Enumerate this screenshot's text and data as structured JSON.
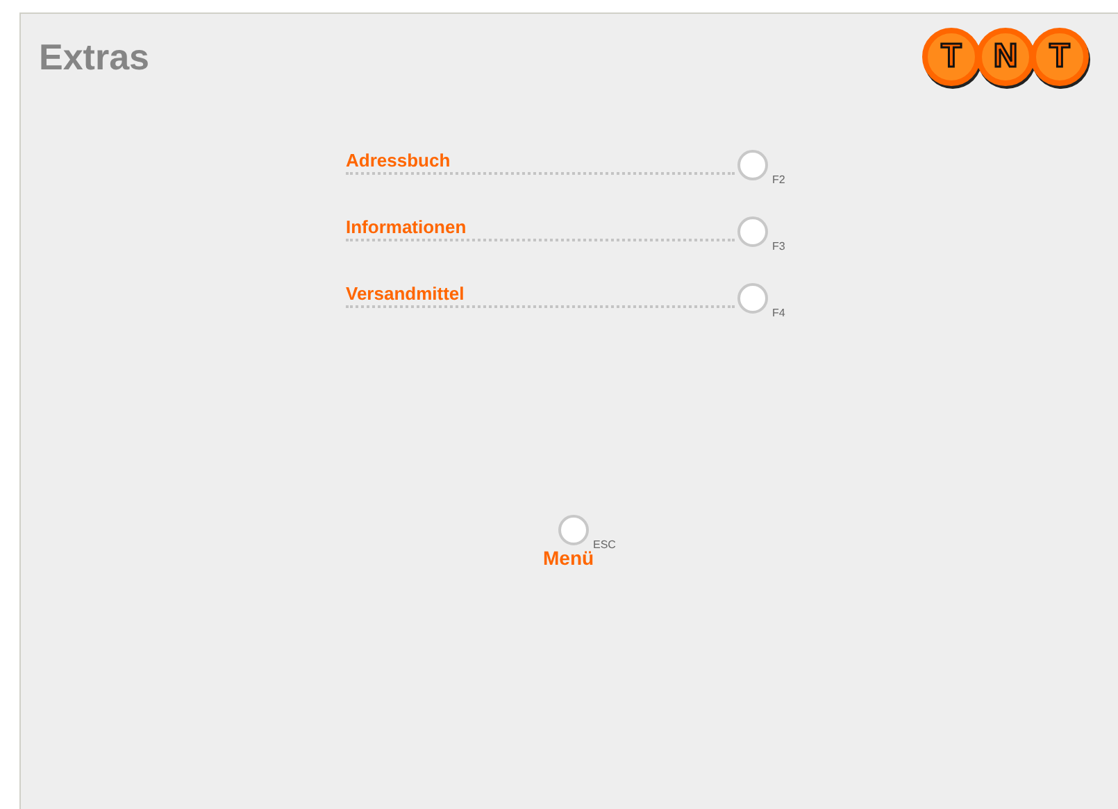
{
  "header": {
    "title": "Extras",
    "logo": [
      "T",
      "N",
      "T"
    ]
  },
  "menu_items": [
    {
      "label": "Adressbuch",
      "key": "F2"
    },
    {
      "label": "Informationen",
      "key": "F3"
    },
    {
      "label": "Versandmittel",
      "key": "F4"
    }
  ],
  "back": {
    "label": "Menü",
    "key": "ESC"
  }
}
